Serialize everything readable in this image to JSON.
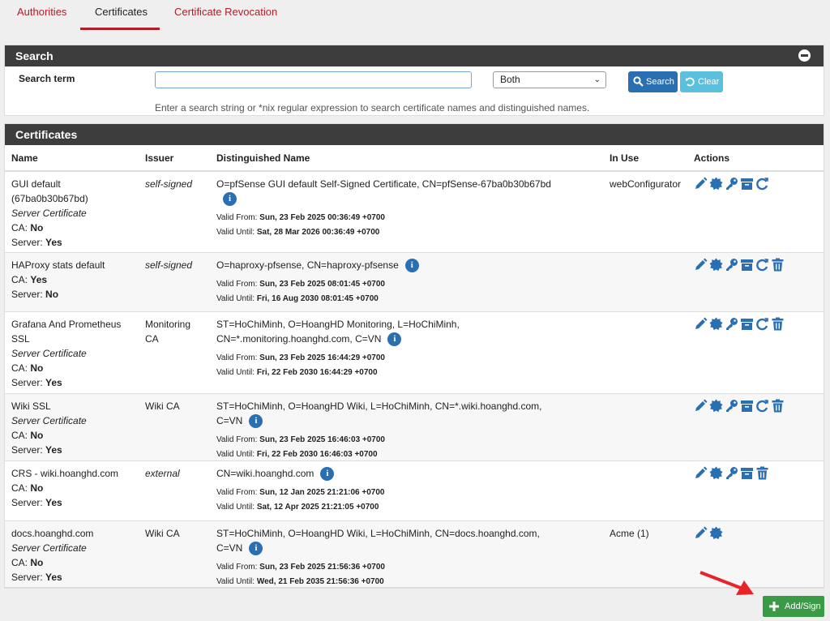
{
  "tabs": [
    "Authorities",
    "Certificates",
    "Certificate Revocation"
  ],
  "search": {
    "title": "Search",
    "label": "Search term",
    "input_value": "",
    "select_value": "Both",
    "search_btn": "Search",
    "clear_btn": "Clear",
    "help": "Enter a search string or *nix regular expression to search certificate names and distinguished names."
  },
  "certs": {
    "title": "Certificates",
    "columns": [
      "Name",
      "Issuer",
      "Distinguished Name",
      "In Use",
      "Actions"
    ],
    "valid_from_label": "Valid From:",
    "valid_until_label": "Valid Until:",
    "ca_label": "CA:",
    "server_label": "Server:",
    "rows": [
      {
        "name1": "GUI default",
        "name2": "(67ba0b30b67bd)",
        "type": "Server Certificate",
        "ca": "No",
        "server": "Yes",
        "issuer": "self-signed",
        "dn1": "O=pfSense GUI default Self-Signed Certificate, CN=pfSense-67ba0b30b67bd",
        "dn2": "",
        "valid_from": "Sun, 23 Feb 2025 00:36:49 +0700",
        "valid_until": "Sat, 28 Mar 2026 00:36:49 +0700",
        "in_use": "webConfigurator"
      },
      {
        "name1": "HAProxy stats default",
        "name2": "",
        "type": "",
        "ca": "Yes",
        "server": "No",
        "issuer": "self-signed",
        "dn1": "O=haproxy-pfsense, CN=haproxy-pfsense",
        "dn2": "",
        "valid_from": "Sun, 23 Feb 2025 08:01:45 +0700",
        "valid_until": "Fri, 16 Aug 2030 08:01:45 +0700",
        "in_use": ""
      },
      {
        "name1": "Grafana And Prometheus",
        "name2": "SSL",
        "type": "Server Certificate",
        "ca": "No",
        "server": "Yes",
        "issuer": "Monitoring",
        "issuer2": "CA",
        "dn1": "ST=HoChiMinh, O=HoangHD Monitoring, L=HoChiMinh,",
        "dn2": "CN=*.monitoring.hoanghd.com, C=VN",
        "valid_from": "Sun, 23 Feb 2025 16:44:29 +0700",
        "valid_until": "Fri, 22 Feb 2030 16:44:29 +0700",
        "in_use": ""
      },
      {
        "name1": "Wiki SSL",
        "name2": "",
        "type": "Server Certificate",
        "ca": "No",
        "server": "Yes",
        "issuer": "Wiki CA",
        "dn1": "ST=HoChiMinh, O=HoangHD Wiki, L=HoChiMinh, CN=*.wiki.hoanghd.com, C=VN",
        "dn2": "",
        "valid_from": "Sun, 23 Feb 2025 16:46:03 +0700",
        "valid_until": "Fri, 22 Feb 2030 16:46:03 +0700",
        "in_use": ""
      },
      {
        "name1": "CRS - wiki.hoanghd.com",
        "name2": "",
        "type": "",
        "ca": "No",
        "server": "Yes",
        "issuer": "external",
        "dn1": "CN=wiki.hoanghd.com",
        "dn2": "",
        "valid_from": "Sun, 12 Jan 2025 21:21:06 +0700",
        "valid_until": "Sat, 12 Apr 2025 21:21:05 +0700",
        "in_use": ""
      },
      {
        "name1": "docs.hoanghd.com",
        "name2": "",
        "type": "Server Certificate",
        "ca": "No",
        "server": "Yes",
        "issuer": "Wiki CA",
        "dn1": "ST=HoChiMinh, O=HoangHD Wiki, L=HoChiMinh, CN=docs.hoanghd.com, C=VN",
        "dn2": "",
        "valid_from": "Sun, 23 Feb 2025 21:56:36 +0700",
        "valid_until": "Wed, 21 Feb 2035 21:56:36 +0700",
        "in_use": "Acme (1)"
      }
    ]
  },
  "add_btn": "Add/Sign",
  "colors": {
    "accent": "#b11e2a",
    "primary": "#2b6fb3",
    "info": "#5bc0de",
    "success": "#3a9a46",
    "header": "#3d3d3d"
  },
  "icons": [
    "info-icon",
    "edit-icon",
    "export-cert-icon",
    "export-key-icon",
    "archive-icon",
    "renew-icon",
    "delete-icon",
    "plus-icon",
    "search-icon",
    "undo-icon",
    "collapse-icon"
  ]
}
